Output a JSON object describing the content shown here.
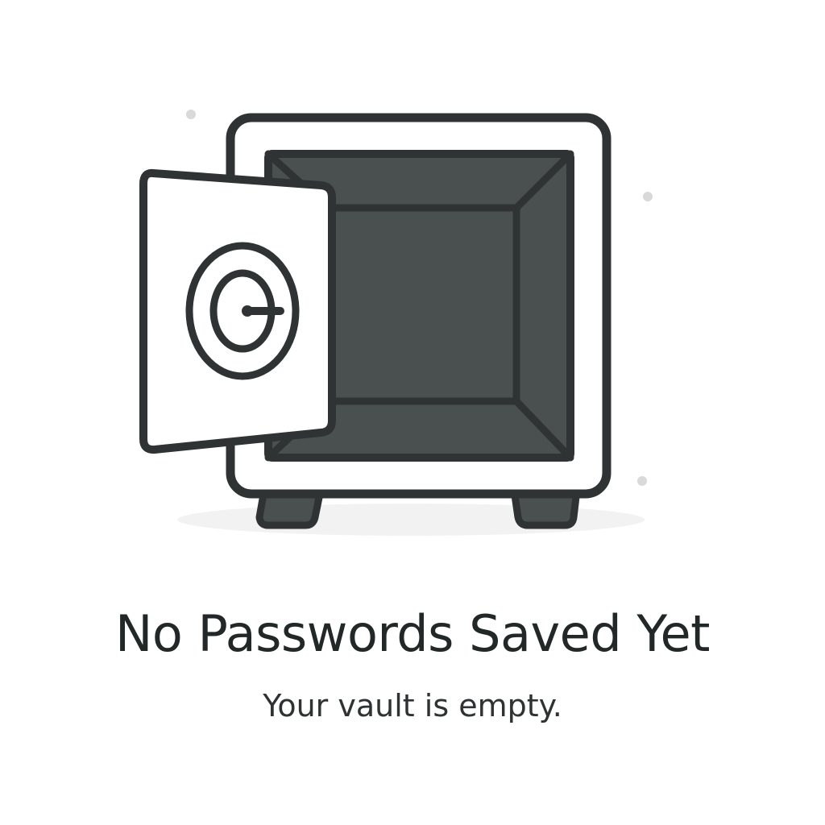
{
  "empty_state": {
    "title": "No Passwords Saved Yet",
    "subtitle": "Your vault is empty."
  },
  "illustration": {
    "icon": "open-safe-icon",
    "colors": {
      "outline": "#2f3334",
      "interior": "#4a4f50",
      "door_fill": "#ffffff",
      "shadow": "#f2f2f2",
      "sparkle": "#d9d9d9"
    }
  }
}
